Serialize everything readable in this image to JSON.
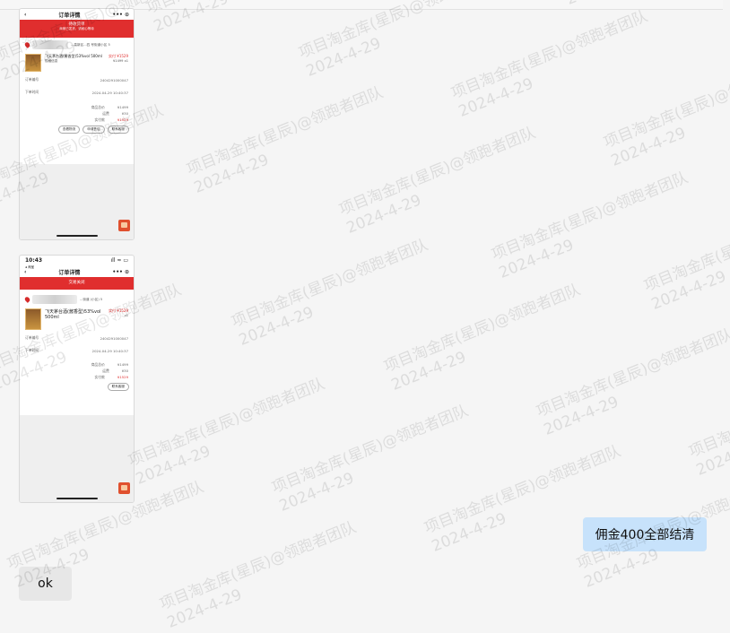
{
  "watermark": {
    "line1": "项目淘金库(星辰)@领跑者团队",
    "line2": "2024-4-29"
  },
  "messages": {
    "screenshot1": {
      "nav_back": "‹",
      "nav_title": "订单详情",
      "nav_icons": "•••  ⊙",
      "banner_line1": "待收货单",
      "banner_line2": "商家已发货，请耐心等待",
      "address_suffix": "...高新区...四 号街道小区 5",
      "product_name": "飞天茅台酒(酱香型)53%vol 500ml",
      "product_spec": "规格信息",
      "product_price": "实付 ¥1529",
      "product_qty": "¥1499  x1",
      "order_no_label": "订单编号",
      "order_no_value": "2404291000047",
      "order_time_label": "下单时间",
      "order_time_value": "2024-04-29 10:40:37",
      "goods_total_label": "商品总价",
      "goods_total_value": "¥1499",
      "shipping_label": "运费",
      "shipping_value": "¥30",
      "paid_label": "实付款",
      "paid_value": "¥1529",
      "btn1": "查看物流",
      "btn2": "申请售后",
      "btn3": "联系客服"
    },
    "screenshot2": {
      "status_time": "10:43",
      "status_left": "◂ 淘宝",
      "status_right": "ıll ≈ ▭",
      "nav_back": "‹",
      "nav_title": "订单详情",
      "nav_icons": "•••  ⊙",
      "banner": "交易关闭",
      "address_suffix": "...街道 (小区) 5",
      "product_name": "飞天茅台酒(酱香型)53%vol 500ml",
      "product_price": "实付 ¥1529",
      "product_qty": "x1",
      "order_no_label": "订单编号",
      "order_no_value": "2404291000047",
      "order_time_label": "下单时间",
      "order_time_value": "2024-04-29 10:40:37",
      "goods_total_label": "商品总价",
      "goods_total_value": "¥1499",
      "shipping_label": "运费",
      "shipping_value": "¥30",
      "paid_label": "实付款",
      "paid_value": "¥1529",
      "btn1": "联系客服"
    },
    "bubble_right": "佣金400全部结清",
    "bubble_left": "ok"
  }
}
